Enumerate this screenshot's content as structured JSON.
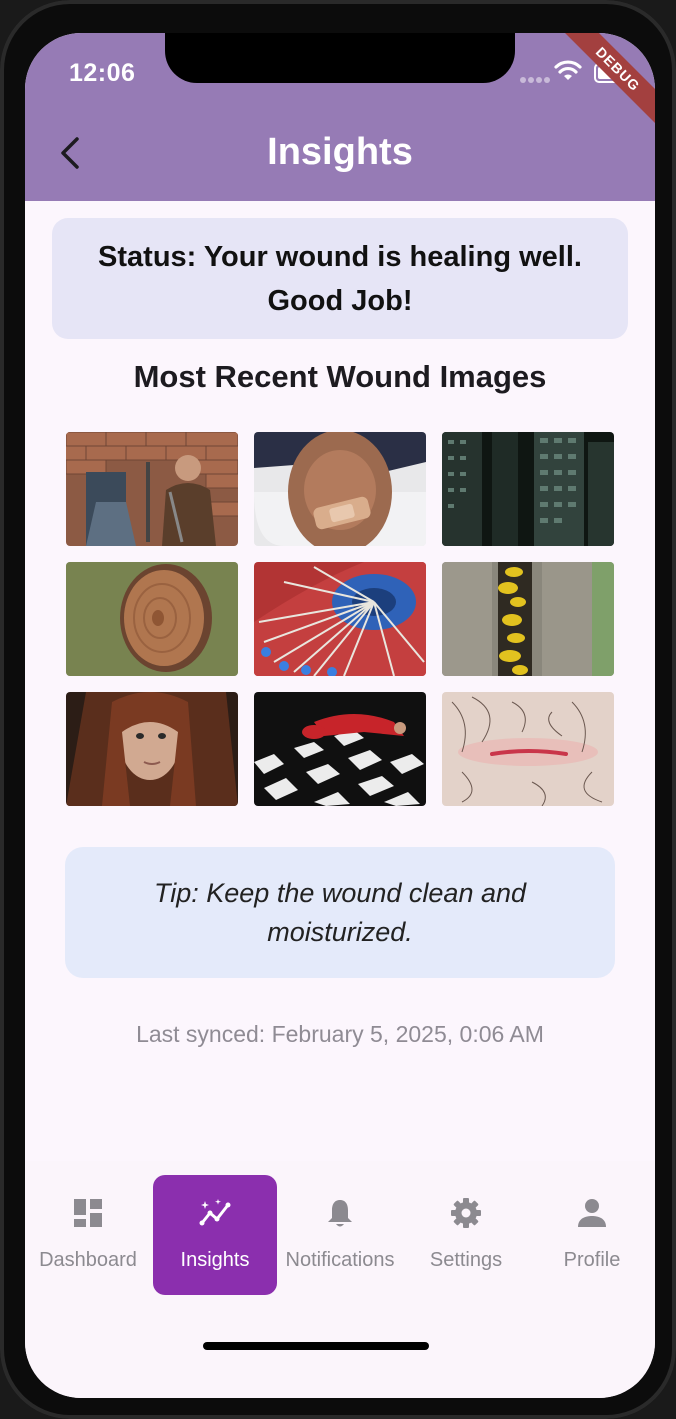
{
  "status_bar": {
    "time": "12:06",
    "debug_banner": "DEBUG"
  },
  "app_bar": {
    "title": "Insights",
    "back_icon": "chevron-left-icon"
  },
  "status_card": {
    "text": "Status: Your wound is healing well. Good Job!"
  },
  "images_section": {
    "title": "Most Recent Wound Images",
    "images": [
      "warrior-in-front-of-brick-wall",
      "knee-with-bandage",
      "tall-apartment-buildings",
      "cut-tree-stump",
      "string-art-on-blue",
      "yellow-fungus-on-bark",
      "woman-with-red-hair",
      "woman-on-checkered-floor",
      "skin-scratch-closeup"
    ]
  },
  "tip_card": {
    "text": "Tip: Keep the wound clean and moisturized."
  },
  "sync": {
    "text": "Last synced: February 5, 2025, 0:06 AM"
  },
  "bottom_nav": {
    "items": [
      {
        "label": "Dashboard",
        "icon": "dashboard-icon"
      },
      {
        "label": "Insights",
        "icon": "insights-icon",
        "active": true
      },
      {
        "label": "Notifications",
        "icon": "bell-icon"
      },
      {
        "label": "Settings",
        "icon": "gear-icon"
      },
      {
        "label": "Profile",
        "icon": "person-icon"
      }
    ]
  },
  "colors": {
    "app_bar": "#967bb5",
    "active_nav": "#8b2fae",
    "status_card_bg": "#e6e5f6",
    "tip_card_bg": "#e4eafa",
    "page_bg": "#fcf6fd"
  }
}
